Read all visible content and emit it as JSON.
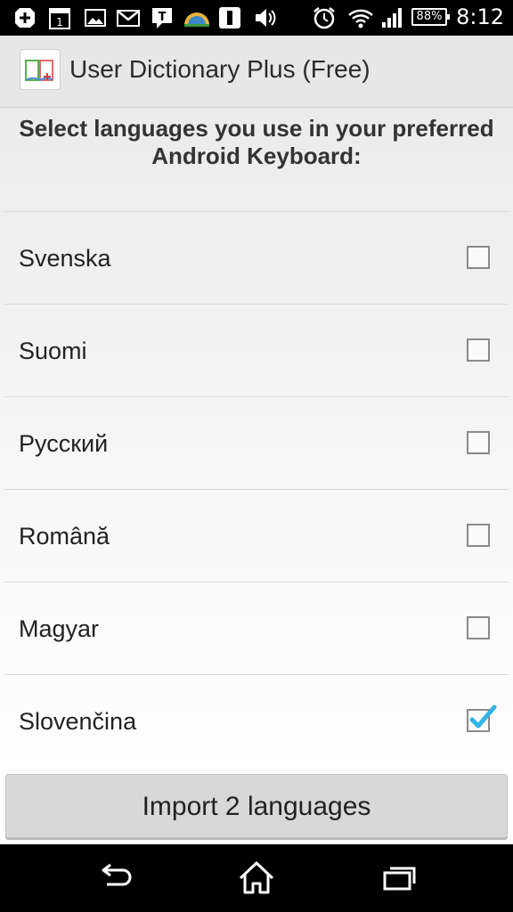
{
  "status_bar": {
    "icons": [
      "add-icon",
      "calendar-icon",
      "gallery-icon",
      "gmail-icon",
      "talk-icon",
      "weather-icon",
      "app-icon",
      "volume-icon",
      "alarm-icon",
      "wifi-icon",
      "signal-icon"
    ],
    "calendar_day": "1",
    "battery_level": "88%",
    "time": "8:12"
  },
  "action_bar": {
    "title": "User Dictionary Plus (Free)"
  },
  "prompt": "Select languages you use in your preferred Android Keyboard:",
  "languages": [
    {
      "label": "Svenska",
      "checked": false
    },
    {
      "label": "Suomi",
      "checked": false
    },
    {
      "label": "Русский",
      "checked": false
    },
    {
      "label": "Română",
      "checked": false
    },
    {
      "label": "Magyar",
      "checked": false
    },
    {
      "label": "Slovenčina",
      "checked": true
    }
  ],
  "import_button": "Import 2 languages",
  "nav_bar": [
    "back-icon",
    "home-icon",
    "recents-icon"
  ],
  "colors": {
    "accent": "#33b5e5"
  }
}
